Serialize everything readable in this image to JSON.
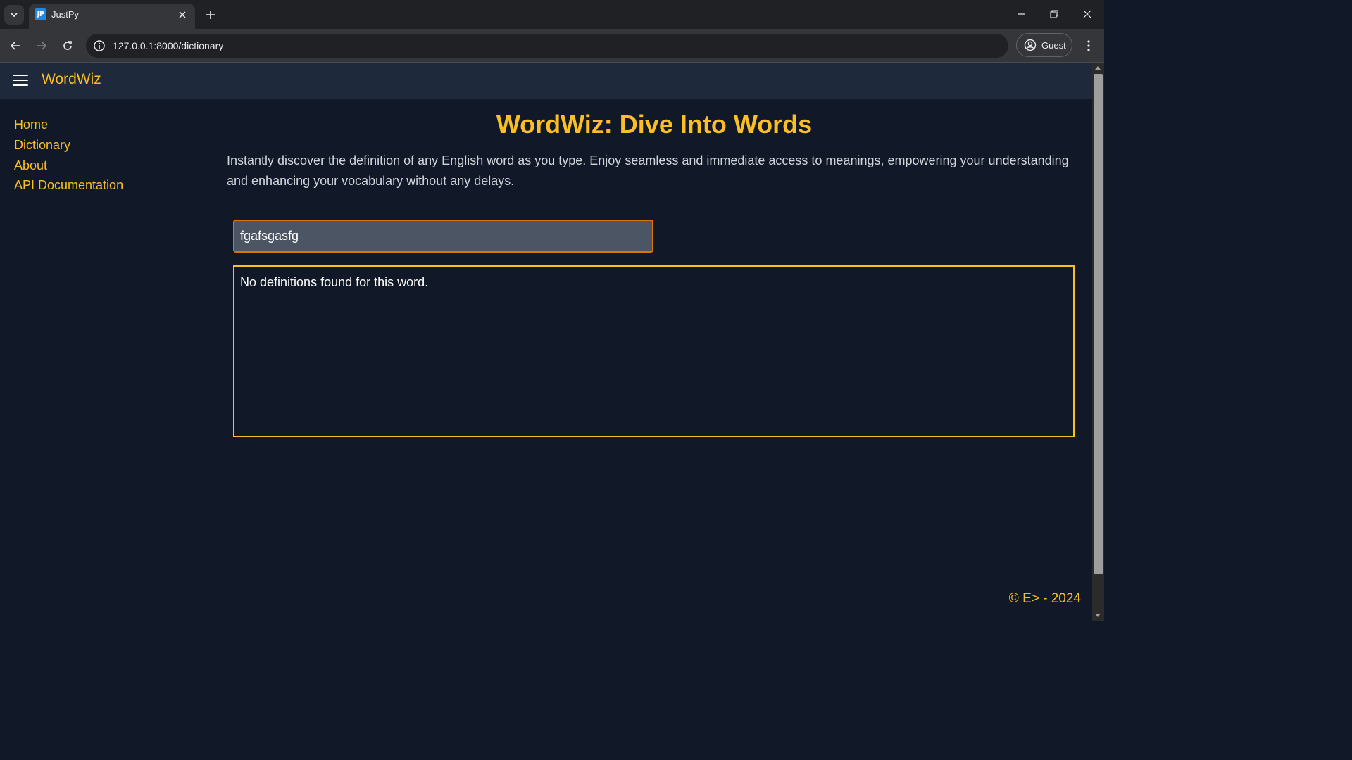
{
  "browser": {
    "tab_title": "JustPy",
    "favicon_text": "JP",
    "url": "127.0.0.1:8000/dictionary",
    "profile_label": "Guest"
  },
  "app": {
    "brand": "WordWiz",
    "nav": [
      {
        "label": "Home"
      },
      {
        "label": "Dictionary"
      },
      {
        "label": "About"
      },
      {
        "label": "API Documentation"
      }
    ],
    "title": "WordWiz: Dive Into Words",
    "intro": "Instantly discover the definition of any English word as you type. Enjoy seamless and immediate access to meanings, empowering your understanding and enhancing your vocabulary without any delays.",
    "search_value": "fgafsgasfg",
    "result_text": "No definitions found for this word.",
    "footer": "© E> - 2024"
  },
  "colors": {
    "accent": "#fbbf24",
    "background": "#111827",
    "header": "#1e293b",
    "input_bg": "#4b5563"
  }
}
